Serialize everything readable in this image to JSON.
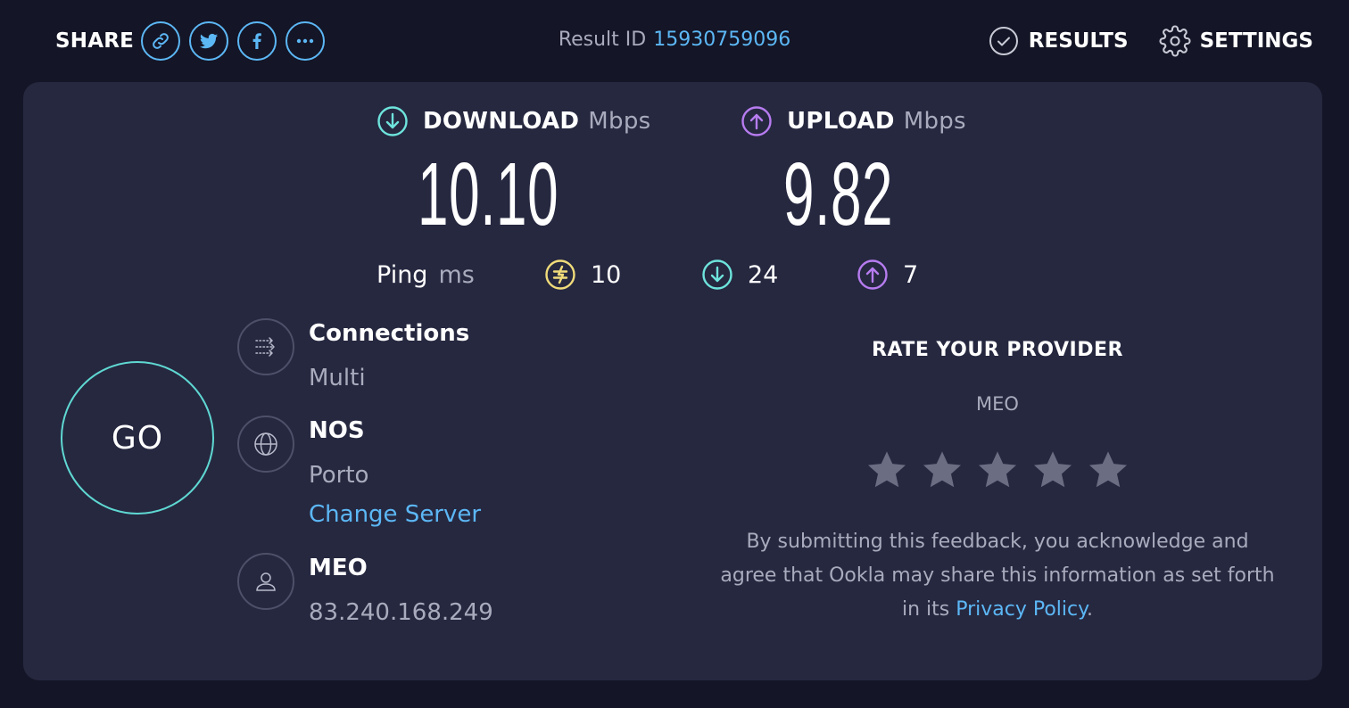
{
  "header": {
    "share_label": "SHARE",
    "share_buttons": [
      "link-icon",
      "twitter-icon",
      "facebook-icon",
      "more-icon"
    ],
    "result_label": "Result ID",
    "result_id": "15930759096",
    "nav": {
      "results": "RESULTS",
      "settings": "SETTINGS"
    }
  },
  "speeds": {
    "download": {
      "label": "DOWNLOAD",
      "unit": "Mbps",
      "value": "10.10",
      "icon": "download-arrow-icon"
    },
    "upload": {
      "label": "UPLOAD",
      "unit": "Mbps",
      "value": "9.82",
      "icon": "upload-arrow-icon"
    }
  },
  "ping": {
    "label": "Ping",
    "unit": "ms",
    "idle": "10",
    "download": "24",
    "upload": "7"
  },
  "go_label": "GO",
  "connections": {
    "title": "Connections",
    "value": "Multi",
    "icon": "connections-icon"
  },
  "server": {
    "title": "NOS",
    "location": "Porto",
    "change_label": "Change Server",
    "icon": "globe-icon"
  },
  "isp": {
    "title": "MEO",
    "ip": "83.240.168.249",
    "icon": "user-icon"
  },
  "rate": {
    "title": "RATE YOUR PROVIDER",
    "provider": "MEO",
    "stars": 5,
    "disclaimer_text": "By submitting this feedback, you acknowledge and agree that Ookla may share this information as set forth in its",
    "privacy_link": "Privacy Policy",
    "disclaimer_end": "."
  },
  "colors": {
    "background": "#141526",
    "panel": "#262840",
    "accent_blue": "#5cb7f5",
    "download_teal": "#6ee4dc",
    "upload_purple": "#b77cf0",
    "ping_yellow": "#f0dc7a",
    "muted_text": "#a9abbd",
    "star": "#6b6e83"
  }
}
